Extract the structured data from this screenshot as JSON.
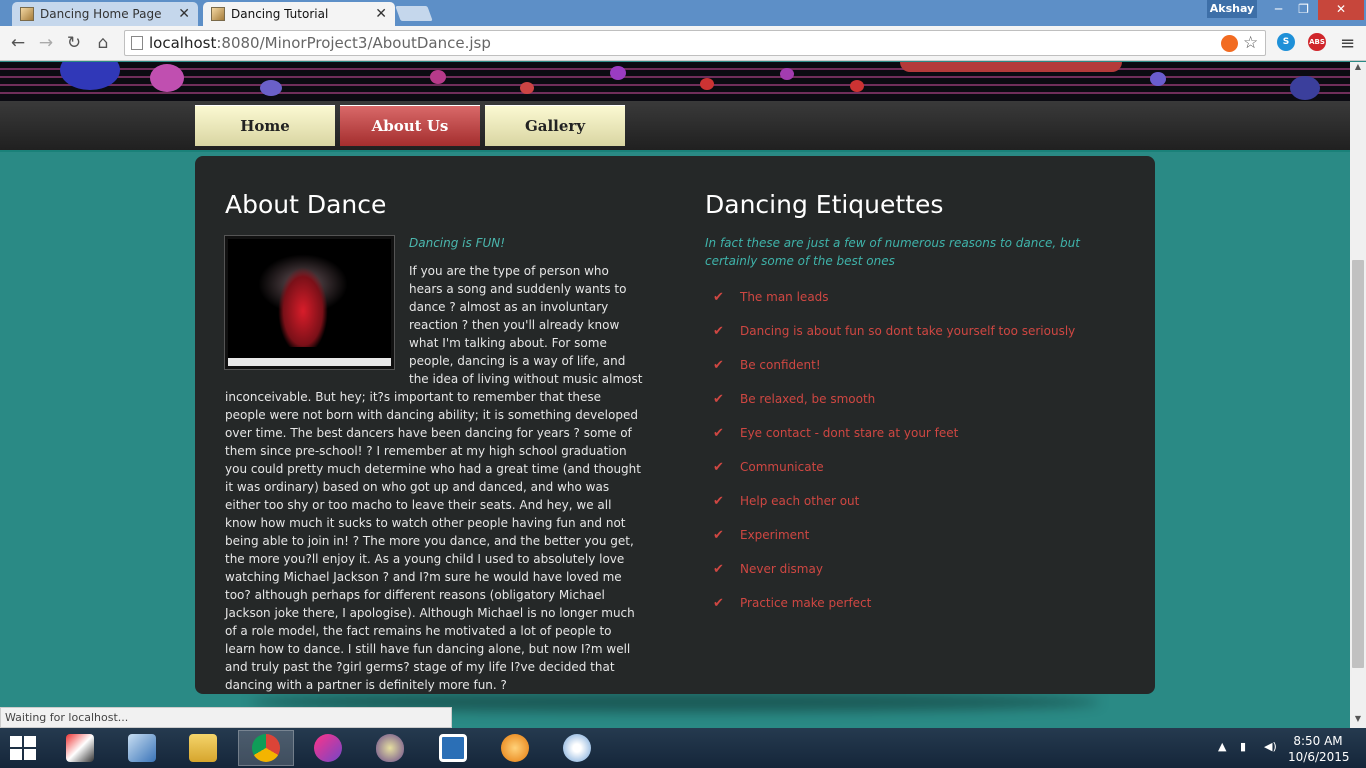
{
  "browser": {
    "tabs": [
      {
        "title": "Dancing Home Page",
        "active": false
      },
      {
        "title": "Dancing Tutorial",
        "active": true
      }
    ],
    "profile_name": "Akshay",
    "url_host": "localhost",
    "url_rest": ":8080/MinorProject3/AboutDance.jsp",
    "status_text": "Waiting for localhost...",
    "extensions": [
      "S",
      "ABS"
    ]
  },
  "nav": {
    "home": "Home",
    "about": "About Us",
    "gallery": "Gallery"
  },
  "about": {
    "heading": "About Dance",
    "tagline": "Dancing is FUN!",
    "body": "If you are the type of person who hears a song and suddenly wants to dance ? almost as an involuntary reaction ? then you'll already know what I'm talking about. For some people, dancing is a way of life, and the idea of living without music almost inconceivable. But hey; it?s important to remember that these people were not born with dancing ability; it is something developed over time. The best dancers have been dancing for years ? some of them since pre-school! ? I remember at my high school graduation you could pretty much determine who had a great time (and thought it was ordinary) based on who got up and danced, and who was either too shy or too macho to leave their seats. And hey, we all know how much it sucks to watch other people having fun and not being able to join in! ? The more you dance, and the better you get, the more you?ll enjoy it. As a young child I used to absolutely love watching Michael Jackson ? and I?m sure he would have loved me too? although perhaps for different reasons (obligatory Michael Jackson joke there, I apologise). Although Michael is no longer much of a role model, the fact remains he motivated a lot of people to learn how to dance. I still have fun dancing alone, but now I?m well and truly past the ?girl germs? stage of my life I?ve decided that dancing with a partner is definitely more fun. ?"
  },
  "etiquettes": {
    "heading": "Dancing Etiquettes",
    "intro": "In fact these are just a few of numerous reasons to dance, but certainly some of the best ones",
    "items": [
      "The man leads",
      "Dancing is about fun so dont take yourself too seriously",
      "Be confident!",
      "Be relaxed, be smooth",
      "Eye contact - dont stare at your feet",
      "Communicate",
      "Help each other out",
      "Experiment",
      "Never dismay",
      "Practice make perfect"
    ]
  },
  "taskbar": {
    "time": "8:50 AM",
    "date": "10/6/2015",
    "apps": [
      "ms-project-icon",
      "virtualbox-icon",
      "file-explorer-icon",
      "chrome-icon",
      "eclipse-icon",
      "tor-browser-icon",
      "shell-icon",
      "vlc-icon",
      "paint-icon"
    ]
  },
  "colors": {
    "accent_teal": "#2a8a85",
    "panel_bg": "#252828",
    "etiquette_red": "#cf4742",
    "tagline_teal": "#4bb7ae",
    "nav_active": "#c34747"
  }
}
